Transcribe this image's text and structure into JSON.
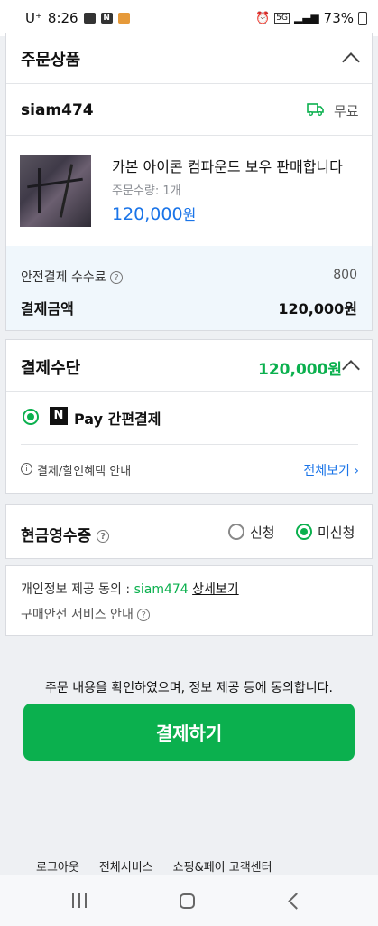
{
  "status_bar": {
    "carrier": "U⁺",
    "time": "8:26",
    "network": "5G",
    "battery": "73%"
  },
  "order_items": {
    "title": "주문상품",
    "seller": "siam474",
    "shipping": "무료",
    "product": {
      "name": "카본 아이콘 컴파운드 보우 판매합니다",
      "quantity": "주문수량: 1개",
      "price": "120,000",
      "price_unit": "원"
    },
    "fee_label": "안전결제 수수료",
    "fee_value": "800",
    "total_label": "결제금액",
    "total_value": "120,000원"
  },
  "payment_method": {
    "title": "결제수단",
    "amount": "120,000원",
    "npay_logo": "N",
    "option_label": "Pay 간편결제",
    "benefit_info": "결제/할인혜택 안내",
    "view_all": "전체보기"
  },
  "cash_receipt": {
    "title": "현금영수증",
    "option_apply": "신청",
    "option_not_apply": "미신청",
    "selected": "미신청"
  },
  "privacy": {
    "consent_label": "개인정보 제공 동의 :",
    "consent_seller": "siam474",
    "consent_link": "상세보기",
    "safe_service": "구매안전 서비스 안내"
  },
  "agree_text": "주문 내용을 확인하였으며, 정보 제공 등에 동의합니다.",
  "pay_button": "결제하기",
  "footer": {
    "links": [
      "로그아웃",
      "전체서비스",
      "쇼핑&페이 고객센터"
    ]
  },
  "colors": {
    "accent_green": "#0bb04e",
    "price_blue": "#1a74e8"
  }
}
